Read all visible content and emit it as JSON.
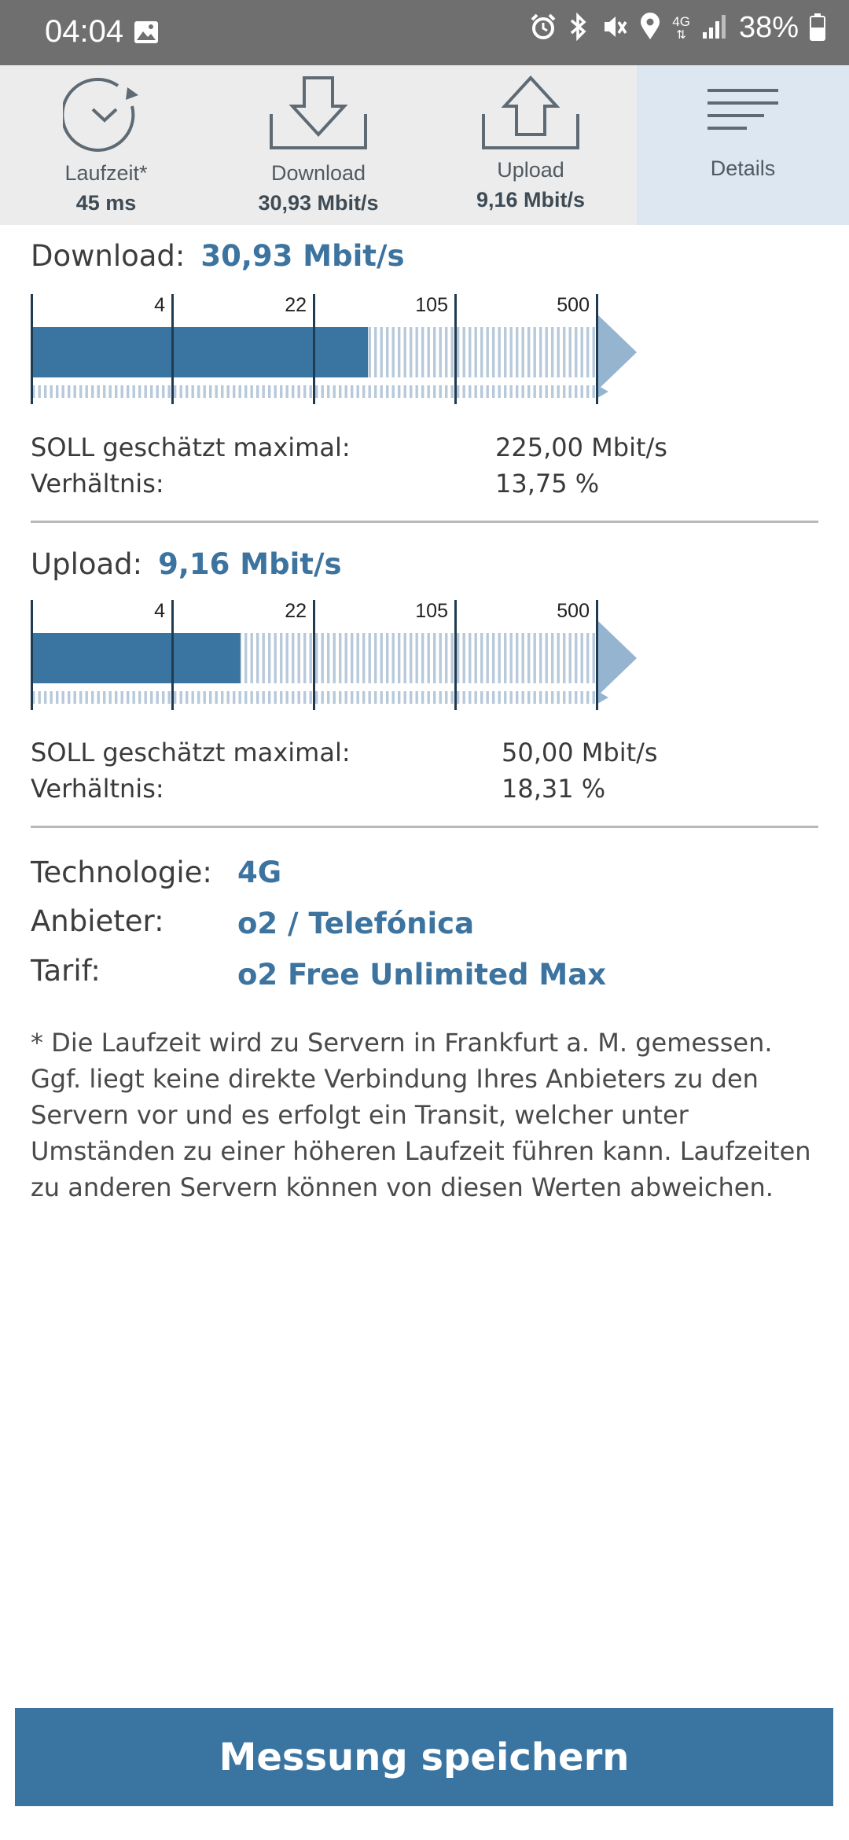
{
  "statusbar": {
    "time": "04:04",
    "network_label": "4G",
    "battery": "38%",
    "icons": [
      "gallery-icon",
      "alarm-icon",
      "bluetooth-icon",
      "vibrate-icon",
      "location-icon",
      "signal-icon",
      "battery-icon"
    ]
  },
  "tabs": [
    {
      "label": "Laufzeit*",
      "value": "45 ms",
      "icon": "latency-icon"
    },
    {
      "label": "Download",
      "value": "30,93 Mbit/s",
      "icon": "download-icon"
    },
    {
      "label": "Upload",
      "value": "9,16 Mbit/s",
      "icon": "upload-icon"
    },
    {
      "label": "Details",
      "value": "",
      "icon": "menu-lines-icon"
    }
  ],
  "download": {
    "title": "Download:",
    "value": "30,93 Mbit/s",
    "scale_ticks": [
      "4",
      "22",
      "105",
      "500"
    ],
    "fill_fraction": 0.595,
    "soll_label": "SOLL geschätzt maximal:",
    "soll_value": "225,00 Mbit/s",
    "ratio_label": "Verhältnis:",
    "ratio_value": "13,75 %"
  },
  "upload": {
    "title": "Upload:",
    "value": "9,16 Mbit/s",
    "scale_ticks": [
      "4",
      "22",
      "105",
      "500"
    ],
    "fill_fraction": 0.37,
    "soll_label": "SOLL geschätzt maximal:",
    "soll_value": "50,00 Mbit/s",
    "ratio_label": "Verhältnis:",
    "ratio_value": "18,31 %"
  },
  "details": {
    "technology_label": "Technologie:",
    "technology_value": "4G",
    "provider_label": "Anbieter:",
    "provider_value": "o2 / Telefónica",
    "tariff_label": "Tarif:",
    "tariff_value": "o2 Free Unlimited Max"
  },
  "footnote": "* Die Laufzeit wird zu Servern in Frankfurt a. M. gemessen. Ggf. liegt keine direkte Verbindung Ihres Anbieters zu den Servern vor und es erfolgt ein Transit, welcher unter Umständen zu einer höheren Laufzeit führen kann. Laufzeiten zu anderen Servern können von diesen Werten abweichen.",
  "save_button": "Messung speichern",
  "colors": {
    "accent": "#3c739f",
    "bar_fill": "#3a75a2",
    "bar_track": "#b7c9da",
    "arrow": "#94b4d0",
    "status_bar": "#6f6f6f"
  }
}
